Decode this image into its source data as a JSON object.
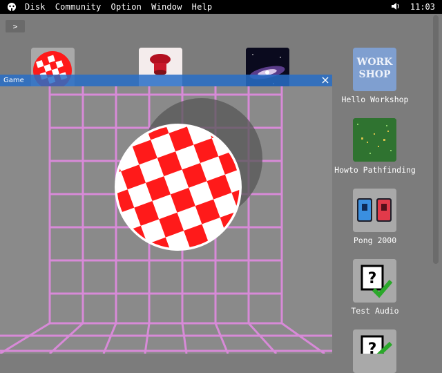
{
  "menubar": {
    "logo_icon": "app-logo-icon",
    "items": [
      "Disk",
      "Community",
      "Option",
      "Window",
      "Help"
    ],
    "volume_icon": "speaker-icon",
    "clock": "11:03"
  },
  "path_button": {
    "label": ">"
  },
  "desktop": {
    "icons": [
      {
        "label": "Hello Workshop",
        "tile_text_line1": "WORK",
        "tile_text_line2": "SHOP"
      },
      {
        "label": "Howto Pathfinding"
      },
      {
        "label": "Pong 2000"
      },
      {
        "label": "Test Audio"
      }
    ]
  },
  "game_window": {
    "title": "Game",
    "close_icon": "close-icon"
  },
  "colors": {
    "menubar_bg": "#000000",
    "desktop_bg": "#7c7c7c",
    "titlebar_bg": "#286ec8",
    "grid_color": "#d88ad8",
    "ball_red": "#ff1a1a",
    "ball_white": "#ffffff"
  }
}
